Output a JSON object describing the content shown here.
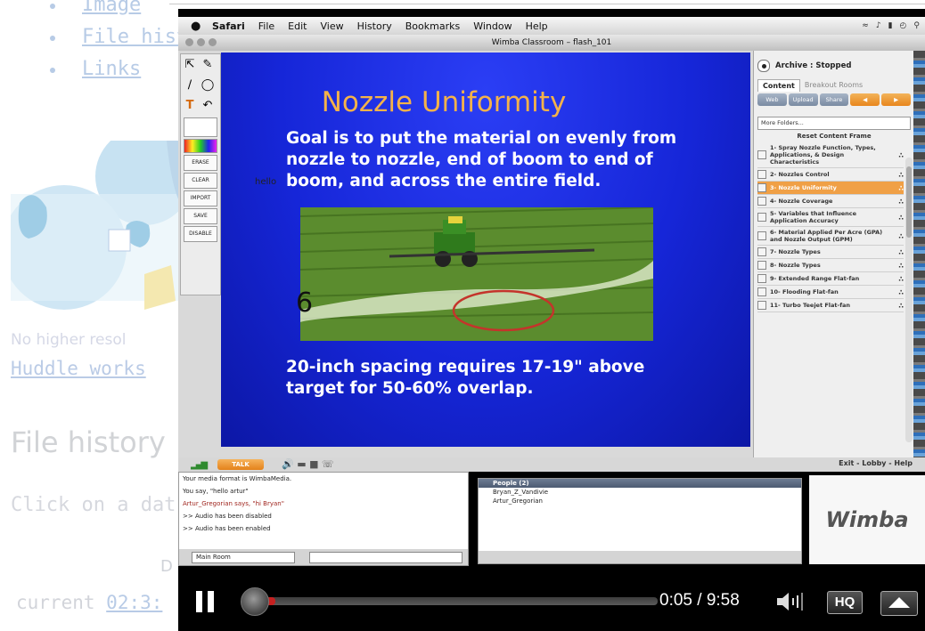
{
  "wiki": {
    "list_items": [
      "Image",
      "File hist",
      "Links"
    ],
    "no_resolution_text": "No higher resol",
    "huddle_link": "Huddle works",
    "file_history_heading": "File history",
    "click_text": "Click on a dat",
    "d_char": "D",
    "current_label": "current",
    "current_time": "02:3:"
  },
  "menubar": {
    "app": "Safari",
    "items": [
      "File",
      "Edit",
      "View",
      "History",
      "Bookmarks",
      "Window",
      "Help"
    ]
  },
  "window": {
    "title": "Wimba Classroom – flash_101"
  },
  "slide": {
    "title": "Nozzle Uniformity",
    "body": "Goal is to put the material on evenly from nozzle to nozzle, end of boom to end of boom, and across the entire field.",
    "bottom": "20-inch spacing requires 17-19\" above target for 50-60% overlap.",
    "annotation_number": "6",
    "hello_text": "hello"
  },
  "content_panel": {
    "archive_status": "Archive : Stopped",
    "tabs": [
      "Content",
      "Breakout Rooms"
    ],
    "buttons": [
      "Web",
      "Upload",
      "Share"
    ],
    "folder_select": "More Folders...",
    "reset_label": "Reset Content Frame",
    "items": [
      {
        "label": "1- Spray Nozzle Function, Types, Applications, & Design Characteristics",
        "selected": false
      },
      {
        "label": "2- Nozzles Control",
        "selected": false
      },
      {
        "label": "3- Nozzle Uniformity",
        "selected": true
      },
      {
        "label": "4- Nozzle Coverage",
        "selected": false
      },
      {
        "label": "5- Variables that Influence Application Accuracy",
        "selected": false
      },
      {
        "label": "6- Material Applied Per Acre (GPA) and Nozzle Output (GPM)",
        "selected": false
      },
      {
        "label": "7- Nozzle Types",
        "selected": false
      },
      {
        "label": "8- Nozzle Types",
        "selected": false
      },
      {
        "label": "9- Extended Range Flat-fan",
        "selected": false
      },
      {
        "label": "10- Flooding Flat-fan",
        "selected": false
      },
      {
        "label": "11- Turbo Teejet Flat-fan",
        "selected": false
      }
    ]
  },
  "statusbar": {
    "talk": "TALK",
    "exit": "Exit - Lobby - Help"
  },
  "chat": {
    "lines": [
      {
        "text": "Your media format is WimbaMedia.",
        "red": false
      },
      {
        "text": "You say, \"hello artur\"",
        "red": false
      },
      {
        "text": "Artur_Gregorian says, \"hi Bryan\"",
        "red": true
      },
      {
        "text": ">> Audio has been disabled",
        "red": false
      },
      {
        "text": ">> Audio has been enabled",
        "red": false
      }
    ],
    "room": "Main Room"
  },
  "people": {
    "header": "People (2)",
    "names": [
      "Bryan_Z_Vandivie",
      "Artur_Gregorian"
    ]
  },
  "wimba_logo": "Wimba",
  "player": {
    "time": "0:05 / 9:58",
    "hq": "HQ",
    "progress": 0.009
  },
  "colors": {
    "slide_blue": "#1626d8",
    "slide_title": "#f4b24a",
    "selected_item": "#f0a046",
    "progress_red": "#c52020"
  }
}
